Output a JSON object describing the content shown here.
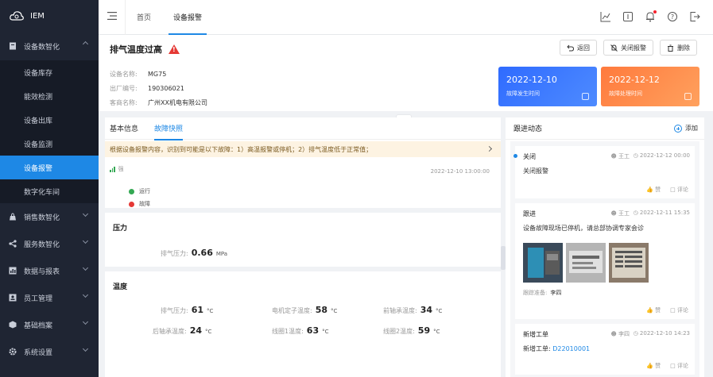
{
  "app": {
    "name": "IEM"
  },
  "sidebar": {
    "items": [
      {
        "label": "设备数智化",
        "icon": "doc-icon",
        "open": true
      },
      {
        "label": "销售数智化",
        "icon": "bag-icon"
      },
      {
        "label": "服务数智化",
        "icon": "share-icon"
      },
      {
        "label": "数据与报表",
        "icon": "chart-icon"
      },
      {
        "label": "员工管理",
        "icon": "user-icon"
      },
      {
        "label": "基础档案",
        "icon": "box-icon"
      },
      {
        "label": "系统设置",
        "icon": "gear-icon"
      }
    ],
    "sub_items": [
      "设备库存",
      "能效检测",
      "设备出库",
      "设备监测",
      "设备报警",
      "数字化车间"
    ],
    "active_sub": "设备报警"
  },
  "topbar": {
    "tabs": [
      "首页",
      "设备报警"
    ]
  },
  "header": {
    "title": "排气温度过高",
    "actions": [
      "返回",
      "关闭报警",
      "删除"
    ],
    "info": [
      {
        "key": "设备名称:",
        "value": "MG75"
      },
      {
        "key": "出厂编号:",
        "value": "190306021"
      },
      {
        "key": "客商名称:",
        "value": "广州XX机电有限公司"
      }
    ],
    "cards": [
      {
        "date": "2022-12-10",
        "label": "故障发生时间",
        "color": "#2f6bff"
      },
      {
        "date": "2022-12-12",
        "label": "故障处理时间",
        "color": "#ff7a3d"
      }
    ]
  },
  "left": {
    "tabs": [
      "基本信息",
      "故障快照"
    ],
    "notice": "根据设备报警内容，识别到可能是以下故障：1）高温报警或停机；2）排气温度低于正常值；",
    "signal": "强",
    "timestamp": "2022-12-10 13:00:00",
    "states": [
      {
        "label": "运行",
        "color": "#34a853"
      },
      {
        "label": "故障",
        "color": "#e53935"
      }
    ],
    "pressure": {
      "title": "压力",
      "items": [
        {
          "key": "排气压力:",
          "value": "0.66",
          "unit": "MPa"
        }
      ]
    },
    "temperature": {
      "title": "温度",
      "items": [
        {
          "key": "排气压力:",
          "value": "61",
          "unit": "°C"
        },
        {
          "key": "电机定子温度:",
          "value": "58",
          "unit": "°C"
        },
        {
          "key": "前轴承温度:",
          "value": "34",
          "unit": "°C"
        },
        {
          "key": "后轴承温度:",
          "value": "24",
          "unit": "°C"
        },
        {
          "key": "线圈1温度:",
          "value": "63",
          "unit": "°C"
        },
        {
          "key": "线圈2温度:",
          "value": "59",
          "unit": "°C"
        }
      ]
    }
  },
  "right": {
    "title": "跟进动态",
    "add_label": "添加",
    "logs": [
      {
        "title": "关闭",
        "who": "王工",
        "when": "2022-12-12 00:00",
        "content": "关闭报警",
        "like": "赞",
        "comment": "评论"
      },
      {
        "title": "跟进",
        "who": "王工",
        "when": "2022-12-11 15:35",
        "content": "设备故障现场已停机，请总部协调专家会诊",
        "by_label": "badge",
        "by_value": "李四",
        "like": "赞",
        "comment": "评论"
      },
      {
        "title": "新增工单",
        "who": "李四",
        "when": "2022-12-10 14:23",
        "content_prefix": "新增工单:",
        "content_link": "D22010001",
        "like": "赞",
        "comment": "评论"
      }
    ],
    "by_label_text": "跟踪准备:"
  }
}
